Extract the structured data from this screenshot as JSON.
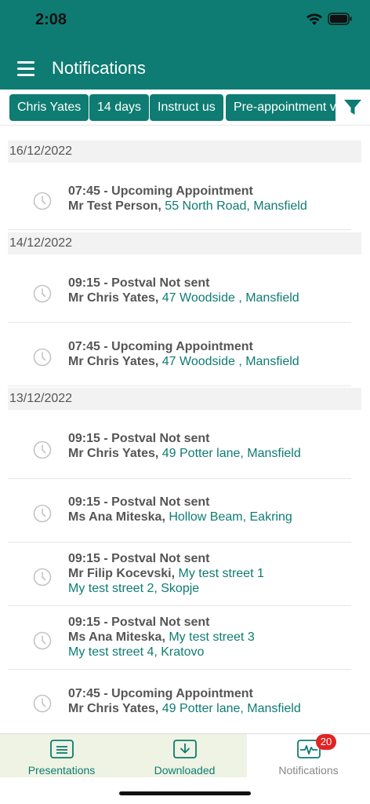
{
  "status_bar": {
    "time": "2:08"
  },
  "app_bar": {
    "title": "Notifications"
  },
  "filters": [
    {
      "label": "Chris Yates"
    },
    {
      "label": "14 days"
    },
    {
      "label": "Instruct us"
    },
    {
      "label": "Pre-appointment v"
    }
  ],
  "groups": [
    {
      "date": "16/12/2022",
      "items": [
        {
          "title": "07:45 - Upcoming Appointment",
          "name": "Mr Test Person,",
          "address": "55 North Road, Mansfield"
        }
      ]
    },
    {
      "date": "14/12/2022",
      "items": [
        {
          "title": "09:15 - Postval Not sent",
          "name": "Mr Chris Yates,",
          "address": "47 Woodside , Mansfield"
        },
        {
          "title": "07:45 - Upcoming Appointment",
          "name": "Mr Chris Yates,",
          "address": "47 Woodside , Mansfield"
        }
      ]
    },
    {
      "date": "13/12/2022",
      "items": [
        {
          "title": "09:15 - Postval Not sent",
          "name": "Mr Chris Yates,",
          "address": "49 Potter lane, Mansfield"
        },
        {
          "title": "09:15 - Postval Not sent",
          "name": "Ms Ana Miteska,",
          "address": "Hollow Beam, Eakring"
        },
        {
          "title": "09:15 - Postval Not sent",
          "name": "Mr Filip Kocevski,",
          "address": "My test street 1",
          "address2": "My test street 2, Skopje"
        },
        {
          "title": "09:15 - Postval Not sent",
          "name": "Ms Ana Miteska,",
          "address": "My test street 3",
          "address2": "My test street 4, Kratovo"
        },
        {
          "title": "07:45 - Upcoming Appointment",
          "name": "Mr Chris Yates,",
          "address": "49 Potter lane, Mansfield"
        }
      ]
    }
  ],
  "tab_bar": {
    "tabs": [
      {
        "label": "Presentations",
        "icon": "presentation-icon"
      },
      {
        "label": "Downloaded",
        "icon": "download-icon"
      },
      {
        "label": "Notifications",
        "icon": "activity-icon",
        "badge": "20"
      }
    ]
  },
  "colors": {
    "primary": "#0e7c72",
    "badge": "#e02424",
    "tab_background": "#eef3e3"
  }
}
